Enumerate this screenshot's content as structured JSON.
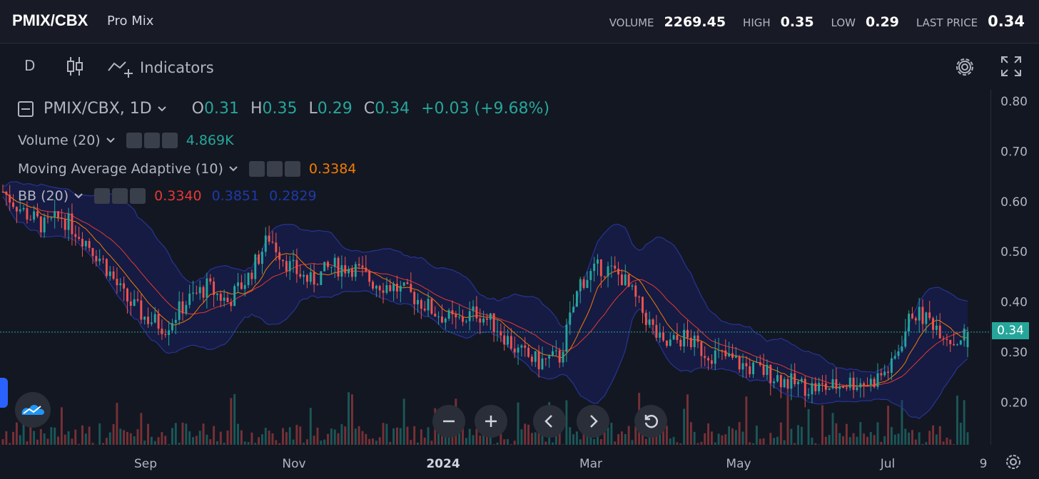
{
  "header": {
    "symbol": "PMIX/CBX",
    "name": "Pro Mix",
    "volume_label": "VOLUME",
    "volume_value": "2269.45",
    "high_label": "HIGH",
    "high_value": "0.35",
    "low_label": "LOW",
    "low_value": "0.29",
    "last_label": "LAST PRICE",
    "last_value": "0.34"
  },
  "toolbar": {
    "interval": "D",
    "indicators_label": "Indicators"
  },
  "legend": {
    "symbol_interval": "PMIX/CBX, 1D",
    "o_key": "O",
    "o_val": "0.31",
    "h_key": "H",
    "h_val": "0.35",
    "l_key": "L",
    "l_val": "0.29",
    "c_key": "C",
    "c_val": "0.34",
    "change": "+0.03 (+9.68%)",
    "volume_name": "Volume (20)",
    "volume_val": "4.869K",
    "maa_name": "Moving Average Adaptive (10)",
    "maa_val": "0.3384",
    "bb_name": "BB (20)",
    "bb_mid": "0.3340",
    "bb_upper": "0.3851",
    "bb_lower": "0.2829"
  },
  "price_tag": "0.34",
  "colors": {
    "up": "#26a69a",
    "down": "#ef5350",
    "maa": "#f57c00",
    "bb_mid": "#e53935",
    "bb_band": "#1a237e",
    "bg": "#131722"
  },
  "icons": {
    "candles": "candlestick-icon",
    "indicators": "indicators-icon",
    "settings": "gear-icon",
    "fullscreen": "fullscreen-icon",
    "zoom_out": "minus-icon",
    "zoom_in": "plus-icon",
    "scroll_left": "chevron-left-icon",
    "scroll_right": "chevron-right-icon",
    "reset": "reset-icon",
    "logo": "cloud-logo-icon",
    "axis_settings": "gear-icon"
  },
  "chart_data": {
    "type": "candlestick",
    "y_ticks": [
      "0.80",
      "0.70",
      "0.60",
      "0.50",
      "0.40",
      "0.30",
      "0.20"
    ],
    "ylim": [
      0.12,
      0.82
    ],
    "x_ticks": [
      "Sep",
      "Nov",
      "2024",
      "Mar",
      "May",
      "Jul",
      "9"
    ],
    "last_price": 0.34,
    "close_anchors": [
      [
        0,
        0.62
      ],
      [
        6,
        0.58
      ],
      [
        12,
        0.55
      ],
      [
        17,
        0.57
      ],
      [
        23,
        0.53
      ],
      [
        29,
        0.48
      ],
      [
        35,
        0.41
      ],
      [
        41,
        0.37
      ],
      [
        47,
        0.35
      ],
      [
        53,
        0.4
      ],
      [
        59,
        0.43
      ],
      [
        65,
        0.4
      ],
      [
        71,
        0.45
      ],
      [
        77,
        0.53
      ],
      [
        83,
        0.47
      ],
      [
        89,
        0.44
      ],
      [
        95,
        0.47
      ],
      [
        101,
        0.47
      ],
      [
        107,
        0.44
      ],
      [
        113,
        0.43
      ],
      [
        119,
        0.41
      ],
      [
        125,
        0.38
      ],
      [
        131,
        0.36
      ],
      [
        137,
        0.38
      ],
      [
        143,
        0.35
      ],
      [
        149,
        0.3
      ],
      [
        155,
        0.28
      ],
      [
        161,
        0.29
      ],
      [
        167,
        0.44
      ],
      [
        173,
        0.47
      ],
      [
        179,
        0.45
      ],
      [
        185,
        0.38
      ],
      [
        191,
        0.31
      ],
      [
        197,
        0.33
      ],
      [
        203,
        0.3
      ],
      [
        209,
        0.29
      ],
      [
        215,
        0.27
      ],
      [
        221,
        0.26
      ],
      [
        227,
        0.24
      ],
      [
        233,
        0.23
      ],
      [
        239,
        0.23
      ],
      [
        245,
        0.24
      ],
      [
        251,
        0.24
      ],
      [
        257,
        0.27
      ],
      [
        263,
        0.38
      ],
      [
        269,
        0.36
      ],
      [
        275,
        0.32
      ],
      [
        279,
        0.34
      ]
    ],
    "volume_range": [
      0,
      6
    ],
    "series": [
      {
        "name": "Moving Average Adaptive (10)",
        "last": 0.3384
      },
      {
        "name": "BB (20)",
        "mid": 0.334,
        "upper": 0.3851,
        "lower": 0.2829
      }
    ]
  }
}
